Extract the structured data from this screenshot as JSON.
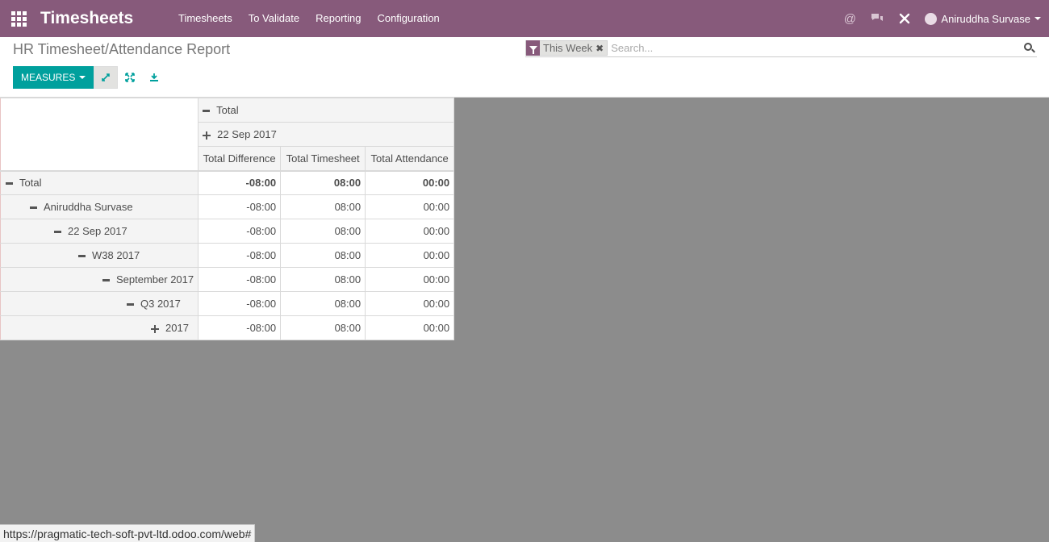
{
  "navbar": {
    "app_title": "Timesheets",
    "menu": [
      "Timesheets",
      "To Validate",
      "Reporting",
      "Configuration"
    ],
    "user_name": "Aniruddha Survase",
    "icons": [
      "at-icon",
      "chat-icon",
      "tools-icon"
    ]
  },
  "control_panel": {
    "breadcrumb": "HR Timesheet/Attendance Report",
    "facet_label": "This Week",
    "search_placeholder": "Search...",
    "measures_label": "MEASURES"
  },
  "pivot": {
    "col_header_total": "Total",
    "col_header_date": "22 Sep 2017",
    "measures": [
      "Total Difference",
      "Total Timesheet",
      "Total Attendance"
    ],
    "rows": [
      {
        "label": "Total",
        "indent": 0,
        "toggle": "minus",
        "bold": true,
        "values": [
          "-08:00",
          "08:00",
          "00:00"
        ]
      },
      {
        "label": "Aniruddha Survase",
        "indent": 1,
        "toggle": "minus",
        "bold": false,
        "values": [
          "-08:00",
          "08:00",
          "00:00"
        ]
      },
      {
        "label": "22 Sep 2017",
        "indent": 2,
        "toggle": "minus",
        "bold": false,
        "values": [
          "-08:00",
          "08:00",
          "00:00"
        ]
      },
      {
        "label": "W38 2017",
        "indent": 3,
        "toggle": "minus",
        "bold": false,
        "values": [
          "-08:00",
          "08:00",
          "00:00"
        ]
      },
      {
        "label": "September 2017",
        "indent": 4,
        "toggle": "minus",
        "bold": false,
        "values": [
          "-08:00",
          "08:00",
          "00:00"
        ]
      },
      {
        "label": "Q3 2017",
        "indent": 5,
        "toggle": "minus",
        "bold": false,
        "values": [
          "-08:00",
          "08:00",
          "00:00"
        ]
      },
      {
        "label": "2017",
        "indent": 6,
        "toggle": "plus",
        "bold": false,
        "values": [
          "-08:00",
          "08:00",
          "00:00"
        ]
      }
    ]
  },
  "statusbar": {
    "url": "https://pragmatic-tech-soft-pvt-ltd.odoo.com/web#"
  },
  "colors": {
    "brand": "#875a7b",
    "accent": "#00a09d",
    "background": "#8c8c8c"
  }
}
